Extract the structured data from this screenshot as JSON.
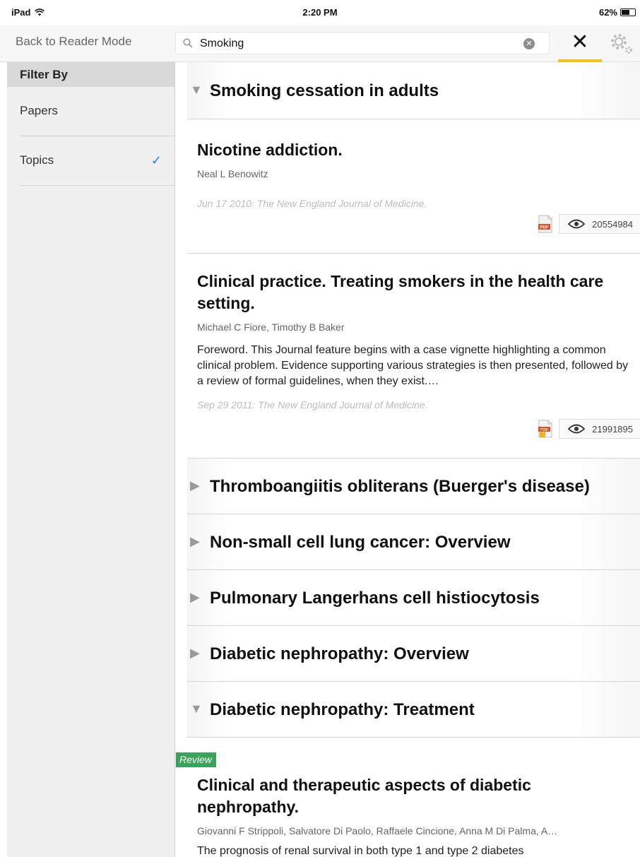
{
  "status": {
    "device": "iPad",
    "time": "2:20 PM",
    "battery": "62%",
    "battery_level": 0.62
  },
  "topbar": {
    "back_label": "Back to Reader Mode",
    "search_value": "Smoking",
    "close_label": "✕"
  },
  "sidebar": {
    "header": "Filter By",
    "items": [
      {
        "label": "Papers",
        "checked": false
      },
      {
        "label": "Topics",
        "checked": true,
        "check": "✓"
      }
    ]
  },
  "topics": [
    {
      "title": "Smoking cessation in adults",
      "expanded": true,
      "papers": [
        {
          "title": "Nicotine addiction.",
          "authors": "Neal L Benowitz",
          "abstract": "",
          "date": "Jun 17 2010: The New England Journal of Medicine.",
          "views": "20554984"
        },
        {
          "title": "Clinical practice. Treating smokers in the health care setting.",
          "authors": "Michael C Fiore, Timothy B Baker",
          "abstract": "Foreword. This Journal feature begins with a case vignette highlighting a common clinical problem. Evidence supporting various strategies is then presented, followed by a review of formal guidelines, when they exist.…",
          "date": "Sep 29 2011: The New England Journal of Medicine.",
          "views": "21991895"
        }
      ]
    },
    {
      "title": "Thromboangiitis obliterans (Buerger's disease)",
      "expanded": false
    },
    {
      "title": "Non-small cell lung cancer: Overview",
      "expanded": false
    },
    {
      "title": "Pulmonary Langerhans cell histiocytosis",
      "expanded": false
    },
    {
      "title": "Diabetic nephropathy: Overview",
      "expanded": false
    },
    {
      "title": "Diabetic nephropathy: Treatment",
      "expanded": true,
      "papers": [
        {
          "badge": "Review",
          "title": "Clinical and therapeutic aspects of diabetic nephropathy.",
          "authors": "Giovanni F Strippoli, Salvatore Di Paolo, Raffaele Cincione, Anna M Di Palma, A…",
          "abstract": "The prognosis of renal survival in both type 1 and type 2 diabetes"
        }
      ]
    }
  ],
  "icons": {
    "expanded": "▼",
    "collapsed": "▶"
  },
  "colors": {
    "accent": "#f2c21b",
    "check": "#2b7fe0",
    "review_badge": "#3aa35a"
  }
}
